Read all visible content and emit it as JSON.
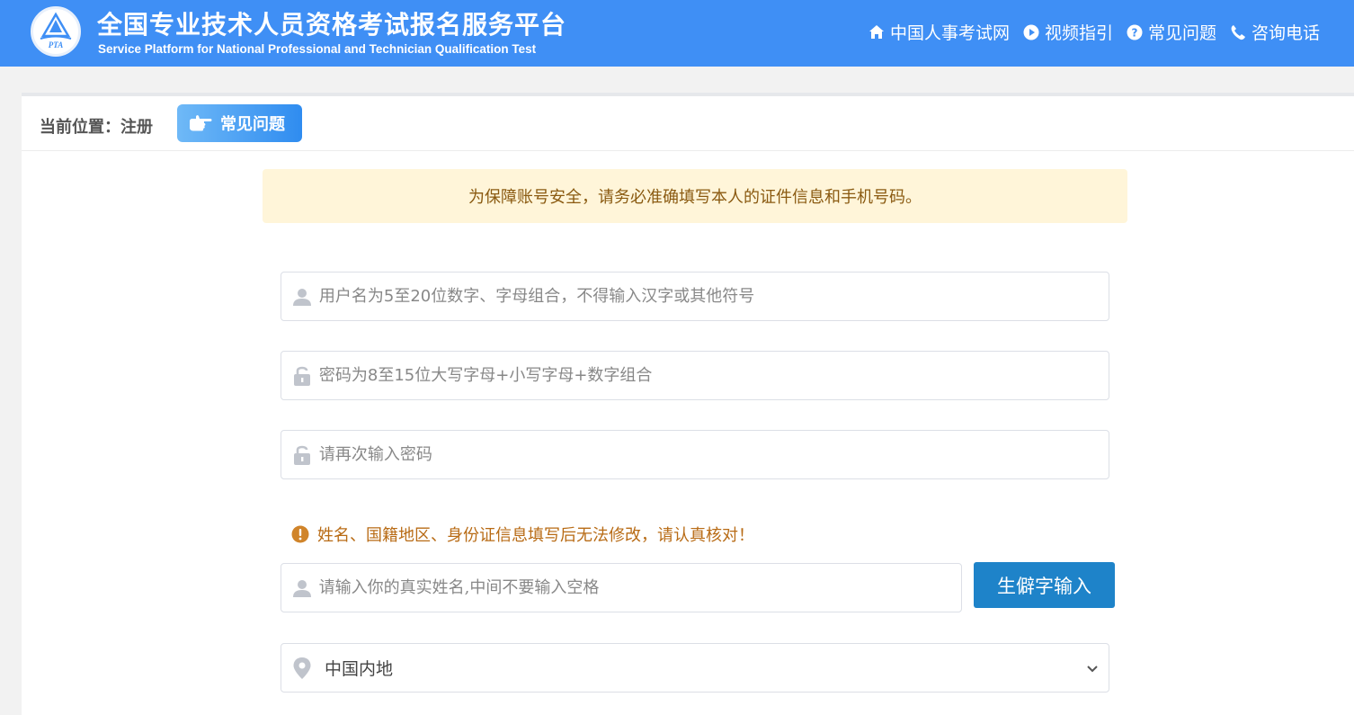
{
  "header": {
    "logo_text": "PTA",
    "title_cn": "全国专业技术人员资格考试报名服务平台",
    "title_en": "Service Platform for National Professional and Technician Qualification Test",
    "bg_color": "#3f8ff5",
    "nav": [
      {
        "label": "中国人事考试网",
        "icon": "home-icon"
      },
      {
        "label": "视频指引",
        "icon": "play-icon"
      },
      {
        "label": "常见问题",
        "icon": "question-icon"
      },
      {
        "label": "咨询电话",
        "icon": "phone-icon"
      }
    ]
  },
  "breadcrumb": {
    "text": "当前位置：注册",
    "faq_button": "常见问题"
  },
  "notice": "为保障账号安全，请务必准确填写本人的证件信息和手机号码。",
  "form": {
    "username_placeholder": "用户名为5至20位数字、字母组合，不得输入汉字或其他符号",
    "password_placeholder": "密码为8至15位大写字母+小写字母+数字组合",
    "confirm_placeholder": "请再次输入密码",
    "warning": "姓名、国籍地区、身份证信息填写后无法修改，请认真核对！",
    "name_placeholder": "请输入你的真实姓名,中间不要输入空格",
    "rare_char_button": "生僻字输入",
    "region_value": "中国内地"
  }
}
